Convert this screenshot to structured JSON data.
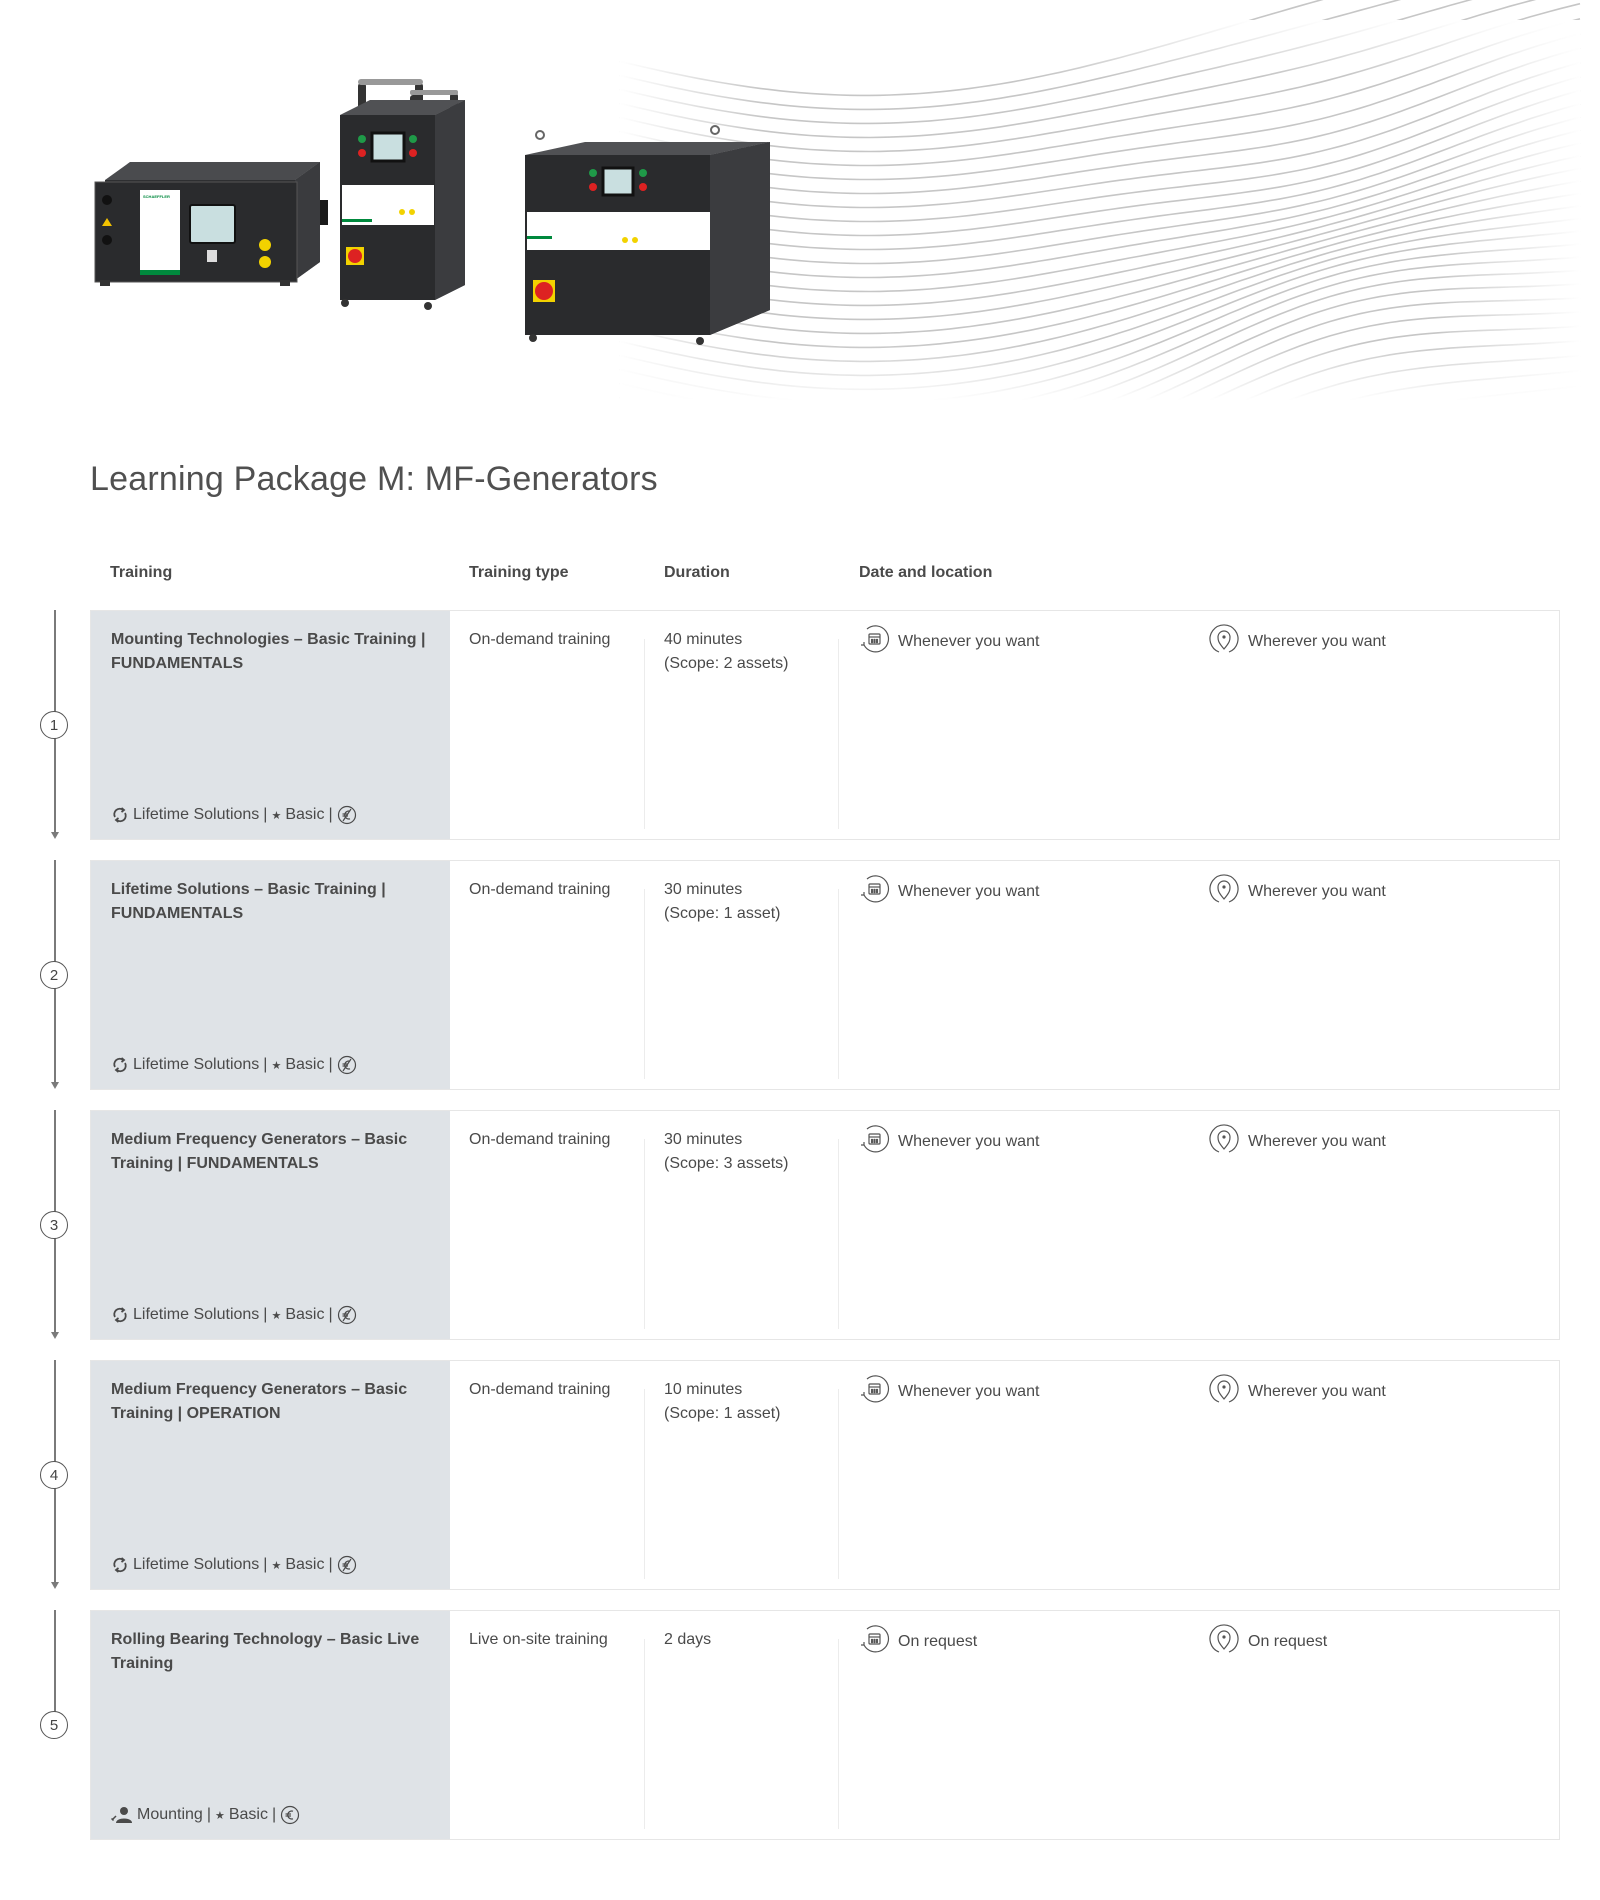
{
  "hero": {
    "image_alt": "Three Schaeffler MF-Generators of different sizes",
    "brand_label": "SCHAEFFLER"
  },
  "page": {
    "title": "Learning Package M: MF-Generators"
  },
  "table": {
    "headers": {
      "training": "Training",
      "training_type": "Training type",
      "duration": "Duration",
      "date_location": "Date and location"
    },
    "rows": [
      {
        "step": "1",
        "name": "Mounting Technologies – Basic Training | FUNDAMENTALS",
        "meta_icon": "refresh-icon",
        "meta_category": "Lifetime Solutions",
        "meta_level": "Basic",
        "price_icon": "free-euro-icon",
        "type": "On-demand training",
        "duration_line1": "40 minutes",
        "duration_line2": "(Scope: 2 assets)",
        "when": "Whenever you want",
        "where": "Wherever you want"
      },
      {
        "step": "2",
        "name": "Lifetime Solutions – Basic Training | FUNDAMENTALS",
        "meta_icon": "refresh-icon",
        "meta_category": "Lifetime Solutions",
        "meta_level": "Basic",
        "price_icon": "free-euro-icon",
        "type": "On-demand training",
        "duration_line1": "30 minutes",
        "duration_line2": "(Scope: 1 asset)",
        "when": "Whenever you want",
        "where": "Wherever you want"
      },
      {
        "step": "3",
        "name": "Medium Frequency Generators – Basic Training | FUNDAMENTALS",
        "meta_icon": "refresh-icon",
        "meta_category": "Lifetime Solutions",
        "meta_level": "Basic",
        "price_icon": "free-euro-icon",
        "type": "On-demand training",
        "duration_line1": "30 minutes",
        "duration_line2": "(Scope: 3 assets)",
        "when": "Whenever you want",
        "where": "Wherever you want"
      },
      {
        "step": "4",
        "name": "Medium Frequency Generators – Basic Training | OPERATION",
        "meta_icon": "refresh-icon",
        "meta_category": "Lifetime Solutions",
        "meta_level": "Basic",
        "price_icon": "free-euro-icon",
        "type": "On-demand training",
        "duration_line1": "10 minutes",
        "duration_line2": "(Scope: 1 asset)",
        "when": "Whenever you want",
        "where": "Wherever you want"
      },
      {
        "step": "5",
        "name": "Rolling Bearing Technology – Basic Live Training",
        "meta_icon": "mechanic-person-icon",
        "meta_category": "Mounting",
        "meta_level": "Basic",
        "price_icon": "paid-euro-icon",
        "type": "Live on-site training",
        "duration_line1": "2 days",
        "duration_line2": "",
        "when": "On request",
        "where": "On request"
      }
    ]
  },
  "colors": {
    "name_cell_bg": "#dfe3e7",
    "text": "#4a4a4a",
    "border": "#e6e6e6",
    "brand_green": "#00893d"
  }
}
